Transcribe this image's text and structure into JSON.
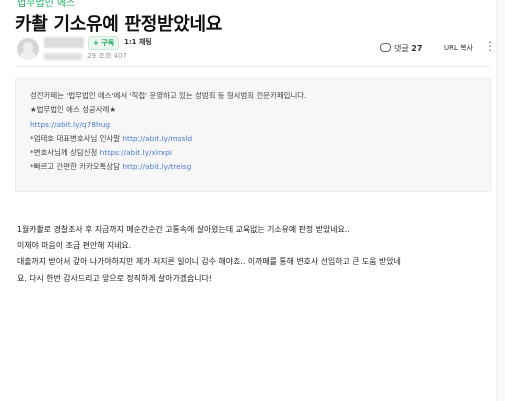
{
  "board": {
    "name": "법무법인 에스"
  },
  "post": {
    "title": "카촬 기소유예 판정받았네요",
    "follow_label": "+ 구독",
    "chat_label": "1:1 채팅",
    "date_fragment": ".29",
    "views_label": "조회",
    "views": "407",
    "comments_label": "댓글",
    "comments_count": "27",
    "url_copy_label": "URL 복사",
    "more_icon": "⋮"
  },
  "notice": {
    "line1": "성전카페는 '법무법인 에스'에서 '직접' 운영하고 있는 성범죄 등 형사범죄 전문카페입니다.",
    "line2": "★법무법인 에스 성공사례★",
    "link1": "https://abit.ly/q78hug",
    "line3_label": "*엄태호 대표변호사님 인사말",
    "line3_link": "http://abit.ly/mssld",
    "line4_label": "*변호사님께 상담신청",
    "line4_link": "https://abit.ly/xlrxpi",
    "line5_label": "*빠르고 간편한 카카오톡상담",
    "line5_link": "http://abit.ly/treisg"
  },
  "body": {
    "p1": "1월카촬로 경찰조사 후 지금까지 메순간순간 고통속에 살아왔는데  교육없는 기소유예 판정 받았네요..",
    "p2": "이제야 마음이 조금 편안해 지네요.",
    "p3": "대출까지 받아서 갚아 나가야하지만 제가 저지른 일이니 감수 해야죠.. 이까페를 통해 변호사 선임하고 큰 도움 받았네",
    "p4": "요. 다시 한번  감사드리고 앞으로 정직하게 살아가겠습니다!"
  }
}
